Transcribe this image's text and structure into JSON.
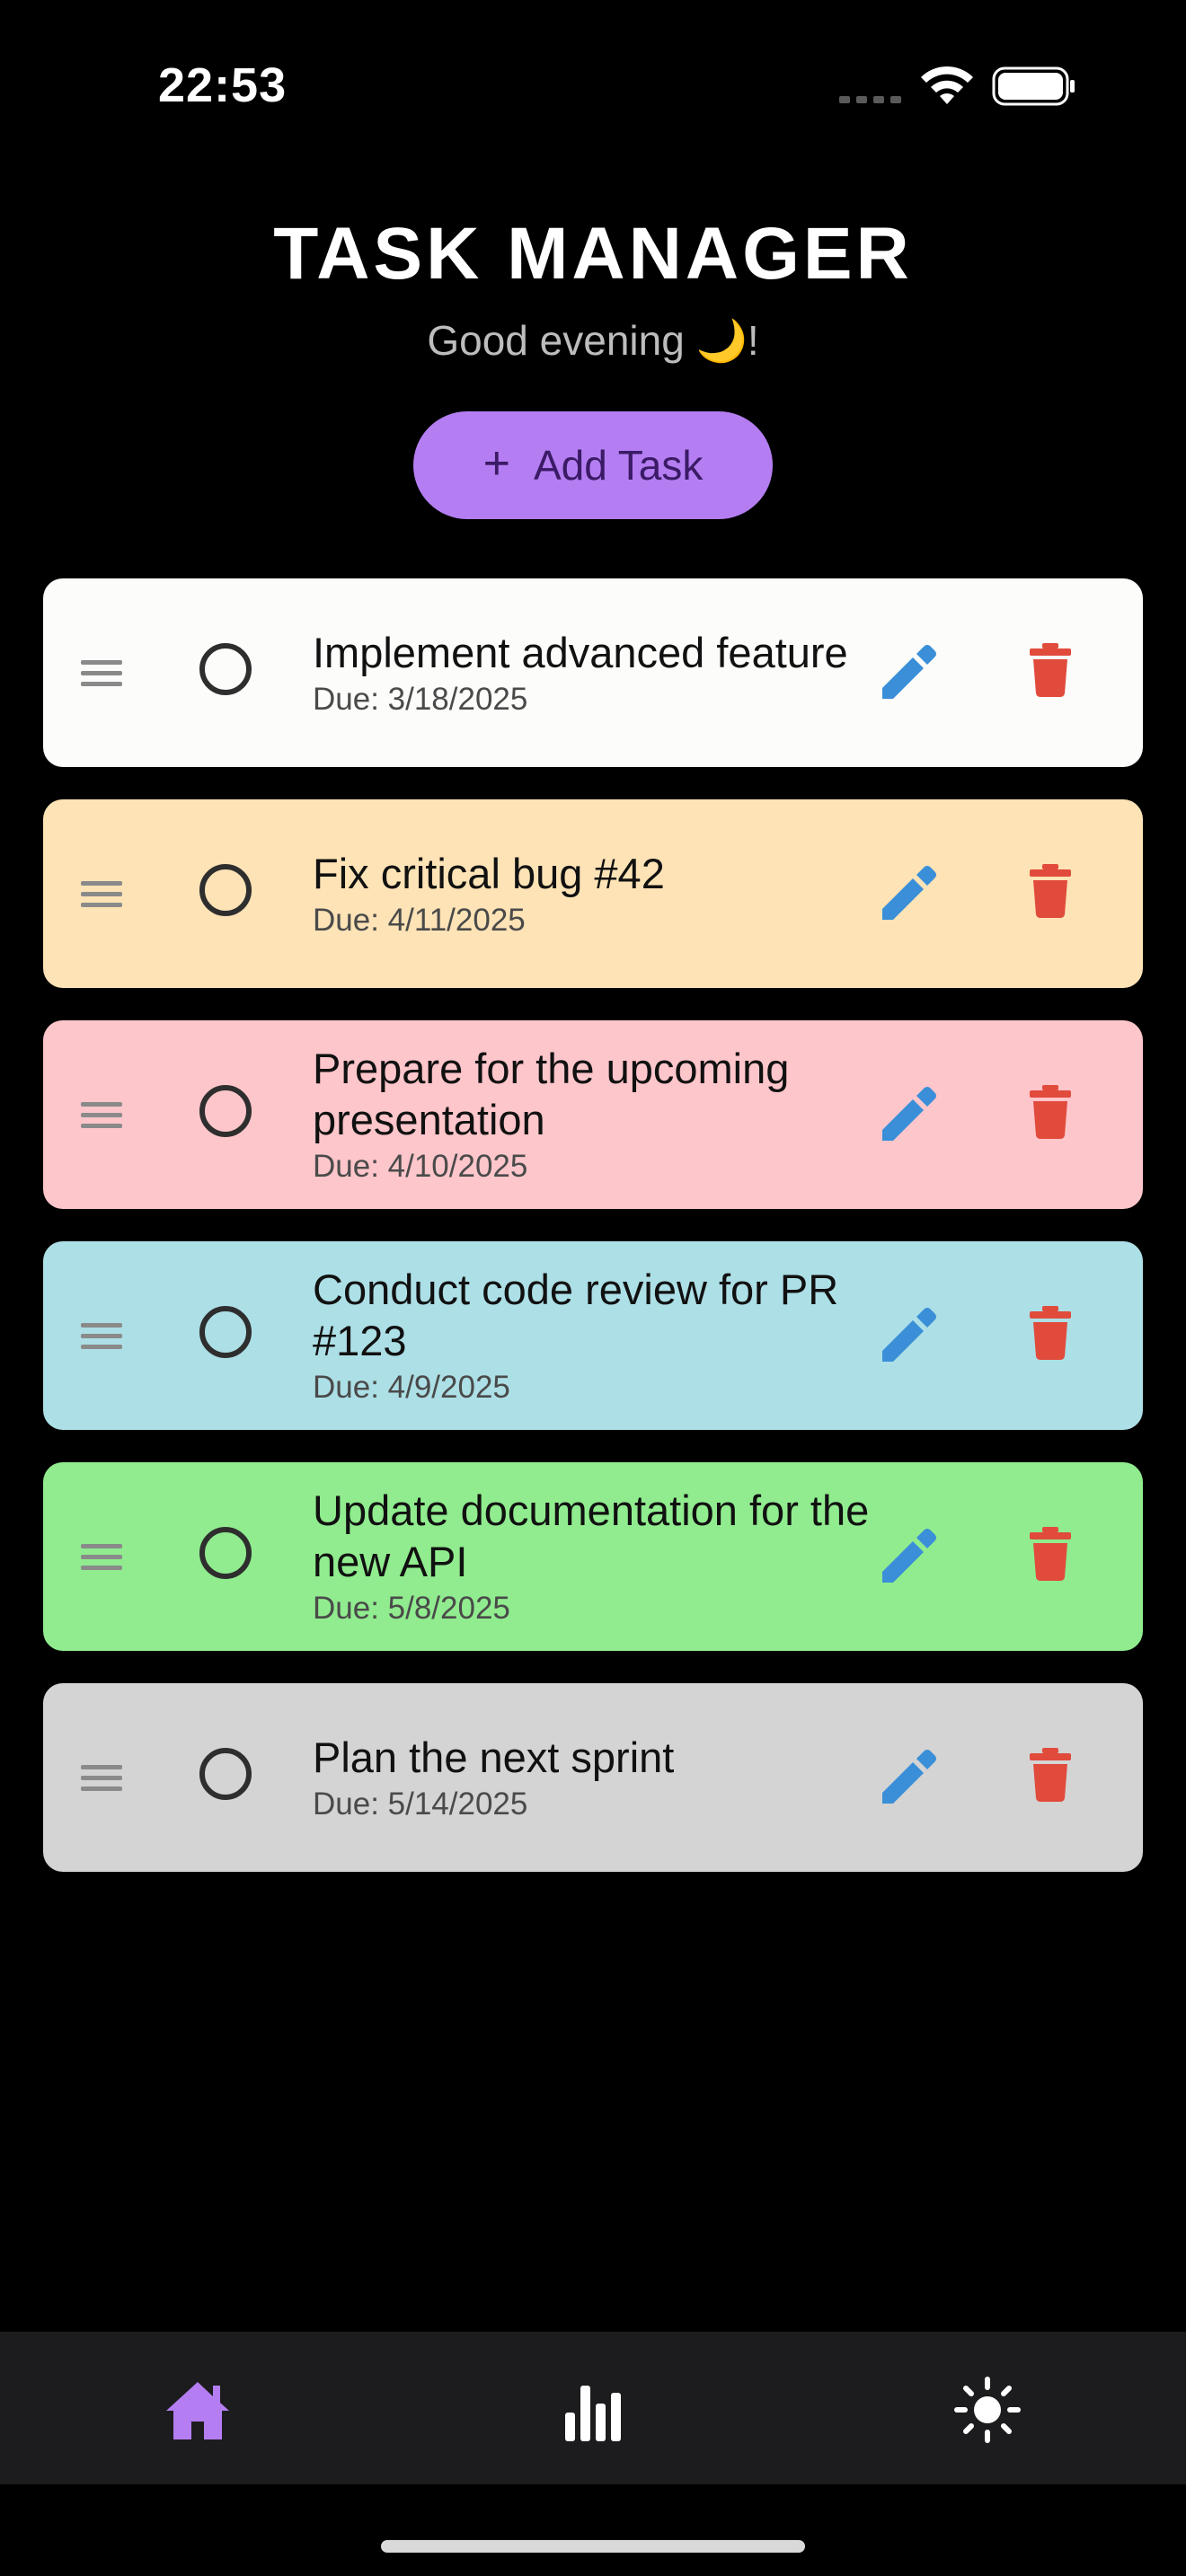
{
  "status_bar": {
    "time": "22:53"
  },
  "header": {
    "title": "TASK MANAGER",
    "greeting": "Good evening 🌙!"
  },
  "add_button": {
    "icon": "+",
    "label": "Add Task"
  },
  "tasks": [
    {
      "title": "Implement advanced feature",
      "due": "Due: 3/18/2025",
      "color": "#fcfcfa",
      "completed": false
    },
    {
      "title": "Fix critical bug #42",
      "due": "Due: 4/11/2025",
      "color": "#fde3b6",
      "completed": false
    },
    {
      "title": "Prepare for the upcoming presentation",
      "due": "Due: 4/10/2025",
      "color": "#fdc6cb",
      "completed": false
    },
    {
      "title": "Conduct code review for PR #123",
      "due": "Due: 4/9/2025",
      "color": "#addfe6",
      "completed": false
    },
    {
      "title": "Update documentation for the new API",
      "due": "Due: 5/8/2025",
      "color": "#90ec8e",
      "completed": false
    },
    {
      "title": "Plan the next sprint",
      "due": "Due: 5/14/2025",
      "color": "#d4d4d4",
      "completed": false
    }
  ],
  "icons": {
    "drag": "drag-handle-icon",
    "check": "circle-checkbox-icon",
    "edit": "pencil-icon",
    "delete": "trash-icon"
  },
  "colors": {
    "accent": "#b47ef2",
    "edit": "#3a8fd8",
    "delete": "#e14b3c",
    "tab_bar": "#1c1c1e"
  },
  "tabs": [
    {
      "name": "home",
      "icon": "home-icon",
      "active": true
    },
    {
      "name": "stats",
      "icon": "bar-chart-icon",
      "active": false
    },
    {
      "name": "theme",
      "icon": "sun-icon",
      "active": false
    }
  ]
}
